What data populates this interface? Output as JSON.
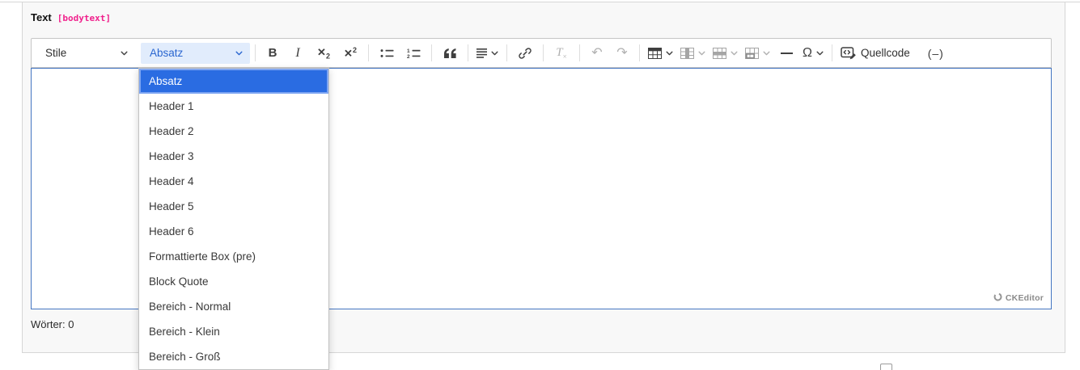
{
  "colors": {
    "accent_blue": "#2a6ce2",
    "selected_ring": "#7fa6f2",
    "editor_focus_border": "#4576c2",
    "active_button_bg": "#e1ecfc",
    "active_button_text": "#2a66d0",
    "field_key_pink": "#f0218c",
    "disabled_icon": "#b0b0b0",
    "icon": "#3f3f3f"
  },
  "field": {
    "label": "Text",
    "key": "[bodytext]"
  },
  "toolbar": {
    "styles_dropdown_label": "Stile",
    "format_dropdown_label": "Absatz",
    "bold_glyph": "B",
    "italic_glyph": "I",
    "subscript_base": "✕",
    "subscript_small": "2",
    "superscript_base": "✕",
    "superscript_small": "2",
    "removeformat_base": "T",
    "removeformat_small": "×",
    "undo_glyph": "↶",
    "redo_glyph": "↷",
    "omega_glyph": "Ω",
    "source_label": "Quellcode",
    "minimize_label": "(–)"
  },
  "format_menu": {
    "items": [
      {
        "label": "Absatz",
        "selected": true
      },
      {
        "label": "Header 1",
        "selected": false
      },
      {
        "label": "Header 2",
        "selected": false
      },
      {
        "label": "Header 3",
        "selected": false
      },
      {
        "label": "Header 4",
        "selected": false
      },
      {
        "label": "Header 5",
        "selected": false
      },
      {
        "label": "Header 6",
        "selected": false
      },
      {
        "label": "Formattierte Box (pre)",
        "selected": false
      },
      {
        "label": "Block Quote",
        "selected": false
      },
      {
        "label": "Bereich - Normal",
        "selected": false
      },
      {
        "label": "Bereich - Klein",
        "selected": false
      },
      {
        "label": "Bereich - Groß",
        "selected": false
      }
    ]
  },
  "editor": {
    "badge_label": "CKEditor",
    "content": ""
  },
  "footer": {
    "word_count": "Wörter: 0"
  }
}
